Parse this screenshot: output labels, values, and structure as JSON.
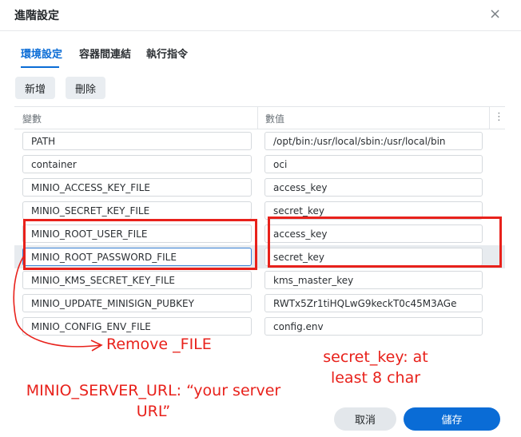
{
  "dialog": {
    "title": "進階設定",
    "close_icon": "×"
  },
  "tabs": [
    {
      "label": "環境設定",
      "active": true
    },
    {
      "label": "容器間連結",
      "active": false
    },
    {
      "label": "執行指令",
      "active": false
    }
  ],
  "toolbar": {
    "add_label": "新增",
    "delete_label": "刪除"
  },
  "table": {
    "headers": {
      "variable": "變數",
      "value": "數值"
    },
    "menu_icon": "⋮",
    "rows": [
      {
        "variable": "PATH",
        "value": "/opt/bin:/usr/local/sbin:/usr/local/bin"
      },
      {
        "variable": "container",
        "value": "oci"
      },
      {
        "variable": "MINIO_ACCESS_KEY_FILE",
        "value": "access_key"
      },
      {
        "variable": "MINIO_SECRET_KEY_FILE",
        "value": "secret_key"
      },
      {
        "variable": "MINIO_ROOT_USER_FILE",
        "value": "access_key"
      },
      {
        "variable": "MINIO_ROOT_PASSWORD_FILE",
        "value": "secret_key"
      },
      {
        "variable": "MINIO_KMS_SECRET_KEY_FILE",
        "value": "kms_master_key"
      },
      {
        "variable": "MINIO_UPDATE_MINISIGN_PUBKEY",
        "value": "RWTx5Zr1tiHQLwG9keckT0c45M3AGe"
      },
      {
        "variable": "MINIO_CONFIG_ENV_FILE",
        "value": "config.env"
      }
    ]
  },
  "annotations": {
    "remove_file": "Remove _FILE",
    "secret_key_note": "secret_key: at least 8 char",
    "server_url_note": "MINIO_SERVER_URL: “your server URL”",
    "color": "#e8211b"
  },
  "footer": {
    "cancel_label": "取消",
    "save_label": "儲存"
  },
  "colors": {
    "accent": "#0a6cd6",
    "annotation_red": "#e8211b"
  }
}
